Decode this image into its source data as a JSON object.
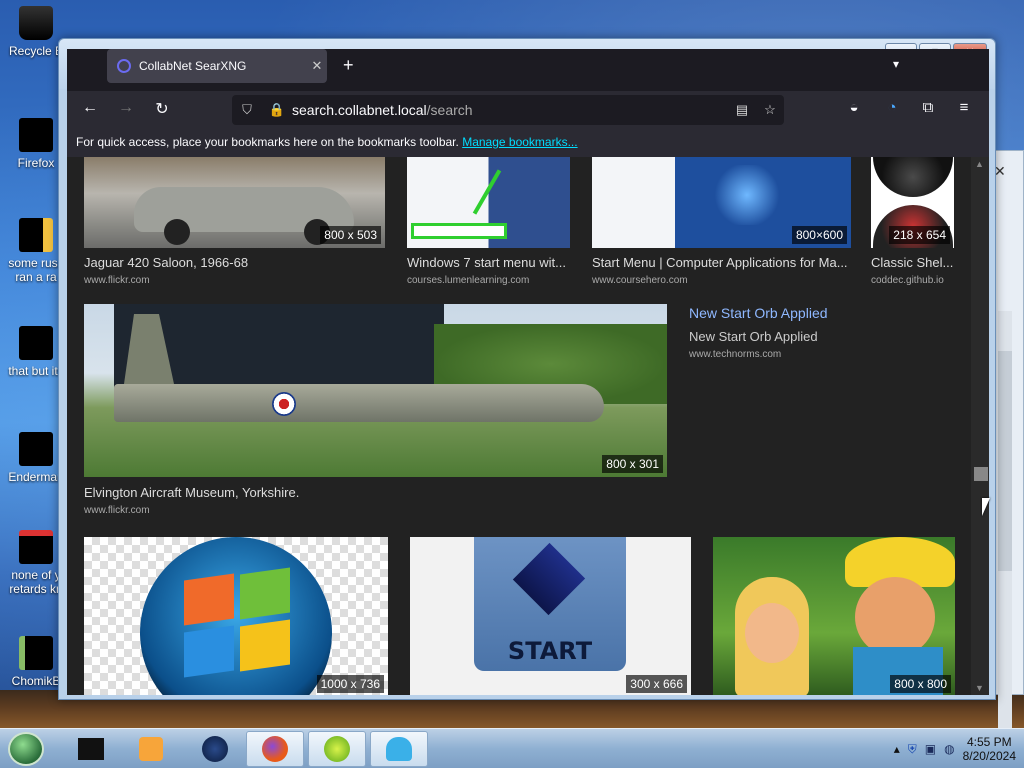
{
  "desktop": {
    "icons": [
      {
        "label": "Recycle Bin",
        "visible": "Recycle B"
      },
      {
        "label": "Firefox",
        "visible": "Firefox"
      },
      {
        "label": "some russ ran a ra",
        "visible": "some russ\nran a ra"
      },
      {
        "label": "that but its",
        "visible": "that but its"
      },
      {
        "label": "Enderman",
        "visible": "Enderman"
      },
      {
        "label": "none of y retards kn",
        "visible": "none of y\nretards kn"
      },
      {
        "label": "ChomikB",
        "visible": "ChomikB"
      }
    ]
  },
  "browser": {
    "tab_title": "CollabNet SearXNG",
    "tab_close": "✕",
    "new_tab": "+",
    "tab_list": "⌄",
    "url_host": "search.collabnet.local",
    "url_path": "/search",
    "bookmarks_hint": "For quick access, place your bookmarks here on the bookmarks toolbar.",
    "manage_bookmarks": "Manage bookmarks..."
  },
  "results": {
    "row1": [
      {
        "title": "Jaguar 420 Saloon, 1966-68",
        "source": "www.flickr.com",
        "dims": "800 x 503"
      },
      {
        "title": "Windows 7 start menu wit...",
        "source": "courses.lumenlearning.com",
        "dims": ""
      },
      {
        "title": "Start Menu | Computer Applications for Ma...",
        "source": "www.coursehero.com",
        "dims": "800×600"
      },
      {
        "title": "Classic Shel...",
        "source": "coddec.github.io",
        "dims": "218 x 654"
      }
    ],
    "featured": {
      "title": "Elvington Aircraft Museum, Yorkshire.",
      "source": "www.flickr.com",
      "dims": "800 x 301"
    },
    "aside": {
      "link_title": "New Start Orb Applied",
      "subtitle": "New Start Orb Applied",
      "source": "www.technorms.com"
    },
    "row3": [
      {
        "dims": "1000 x 736"
      },
      {
        "start_label": "START",
        "dims": "300 x 666"
      },
      {
        "dims": "800 x 800"
      }
    ]
  },
  "taskbar": {
    "time": "4:55 PM",
    "date": "8/20/2024"
  }
}
